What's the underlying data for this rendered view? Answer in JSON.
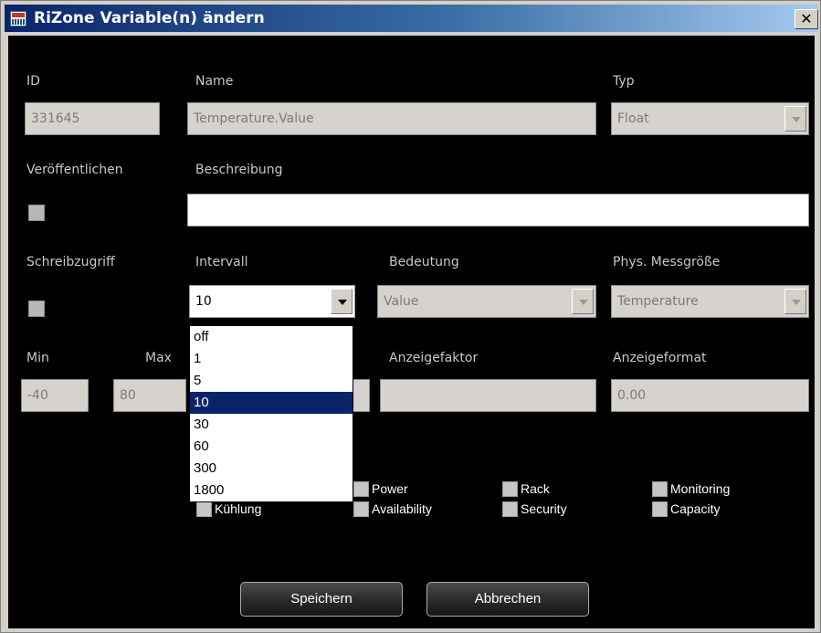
{
  "window": {
    "title": "RiZone Variable(n) ändern",
    "close_symbol": "✕"
  },
  "labels": {
    "id": "ID",
    "name": "Name",
    "typ": "Typ",
    "veroeffentlichen": "Veröffentlichen",
    "beschreibung": "Beschreibung",
    "schreibzugriff": "Schreibzugriff",
    "intervall": "Intervall",
    "bedeutung": "Bedeutung",
    "phys": "Phys. Messgröße",
    "min": "Min",
    "max": "Max",
    "anzeigefaktor": "Anzeigefaktor",
    "anzeigeformat": "Anzeigeformat"
  },
  "fields": {
    "id": "331645",
    "name": "Temperature.Value",
    "typ": "Float",
    "beschreibung": "",
    "intervall": "10",
    "bedeutung": "Value",
    "phys": "Temperature",
    "min": "-40",
    "max": "80",
    "anzeigefaktor": "",
    "anzeigeformat": "0.00"
  },
  "intervall_options": [
    "off",
    "1",
    "5",
    "10",
    "30",
    "60",
    "300",
    "1800"
  ],
  "intervall_selected": "10",
  "categories": {
    "partial": "Kühlung",
    "power": "Power",
    "availability": "Availability",
    "rack": "Rack",
    "security": "Security",
    "monitoring": "Monitoring",
    "capacity": "Capacity"
  },
  "buttons": {
    "save": "Speichern",
    "cancel": "Abbrechen"
  },
  "colors": {
    "title_bar": "#0a246a",
    "dialog_bg": "#000000",
    "selection": "#0a246a"
  }
}
